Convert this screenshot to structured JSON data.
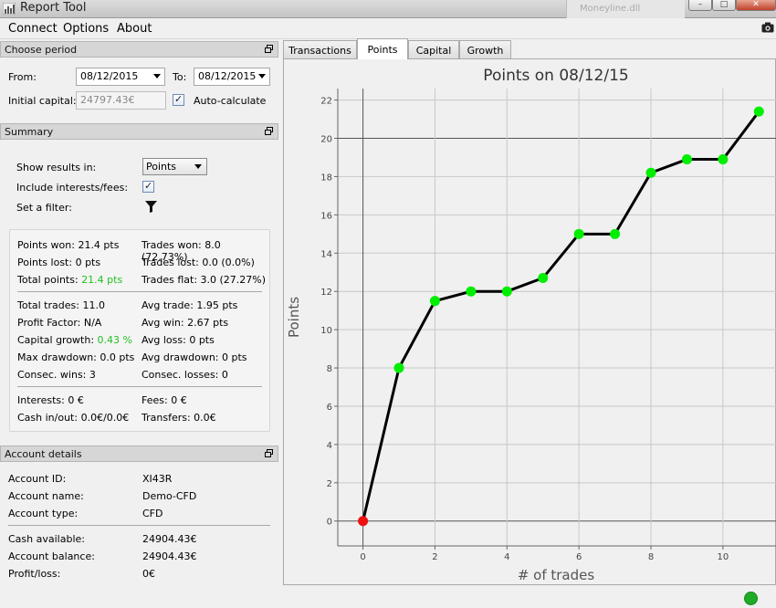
{
  "window": {
    "title": "Report Tool",
    "background_window_title": "Moneyline.dll"
  },
  "menu": {
    "items": [
      "Connect",
      "Options",
      "About"
    ]
  },
  "choose_period": {
    "header": "Choose period",
    "from_label": "From:",
    "from_value": "08/12/2015",
    "to_label": "To:",
    "to_value": "08/12/2015",
    "initial_capital_label": "Initial capital:",
    "initial_capital_value": "24797.43€",
    "auto_calculate_label": "Auto-calculate"
  },
  "summary": {
    "header": "Summary",
    "show_results_label": "Show results in:",
    "show_results_value": "Points",
    "include_interests_label": "Include interests/fees:",
    "set_filter_label": "Set a filter:",
    "stats": {
      "points_won": "Points won: 21.4 pts",
      "trades_won": "Trades won: 8.0 (72.73%)",
      "points_lost": "Points lost: 0 pts",
      "trades_lost": "Trades lost: 0.0 (0.0%)",
      "total_points_label": "Total points:",
      "total_points_value": "21.4 pts",
      "trades_flat": "Trades flat: 3.0 (27.27%)",
      "total_trades": "Total trades: 11.0",
      "avg_trade": "Avg trade: 1.95 pts",
      "profit_factor": "Profit Factor: N/A",
      "avg_win": "Avg win: 2.67 pts",
      "capital_growth_label": "Capital growth:",
      "capital_growth_value": "0.43 %",
      "avg_loss": "Avg loss: 0 pts",
      "max_drawdown": "Max drawdown: 0.0 pts",
      "avg_drawdown": "Avg drawdown: 0 pts",
      "consec_wins": "Consec. wins: 3",
      "consec_losses": "Consec. losses: 0",
      "interests": "Interests: 0 €",
      "fees": "Fees: 0 €",
      "cash_in_out": "Cash in/out: 0.0€/0.0€",
      "transfers": "Transfers: 0.0€"
    }
  },
  "account": {
    "header": "Account details",
    "rows_top": [
      {
        "label": "Account ID:",
        "value": "XI43R"
      },
      {
        "label": "Account name:",
        "value": "Demo-CFD"
      },
      {
        "label": "Account type:",
        "value": "CFD"
      }
    ],
    "rows_bottom": [
      {
        "label": "Cash available:",
        "value": "24904.43€"
      },
      {
        "label": "Account balance:",
        "value": "24904.43€"
      },
      {
        "label": "Profit/loss:",
        "value": "0€"
      }
    ]
  },
  "tabs": [
    "Transactions",
    "Points",
    "Capital",
    "Growth"
  ],
  "active_tab": "Points",
  "colors": {
    "accent_green": "#22c022",
    "marker_green": "#00ee00",
    "marker_red": "#ee1111",
    "status_green": "#1faa28"
  },
  "chart_data": {
    "type": "line",
    "title": "Points on 08/12/15",
    "xlabel": "# of trades",
    "ylabel": "Points",
    "x": [
      0,
      1,
      2,
      3,
      4,
      5,
      6,
      7,
      8,
      9,
      10,
      11
    ],
    "y": [
      0,
      8.0,
      11.5,
      12.0,
      12.0,
      12.7,
      15.0,
      15.0,
      18.2,
      18.9,
      18.9,
      21.4
    ],
    "xlim": [
      -0.7,
      11.5
    ],
    "ylim": [
      -1.3,
      22.6
    ],
    "xticks": [
      0,
      2,
      4,
      6,
      8,
      10
    ],
    "yticks": [
      0,
      2,
      4,
      6,
      8,
      10,
      12,
      14,
      16,
      18,
      20,
      22
    ],
    "grid": true,
    "legend": "none"
  }
}
